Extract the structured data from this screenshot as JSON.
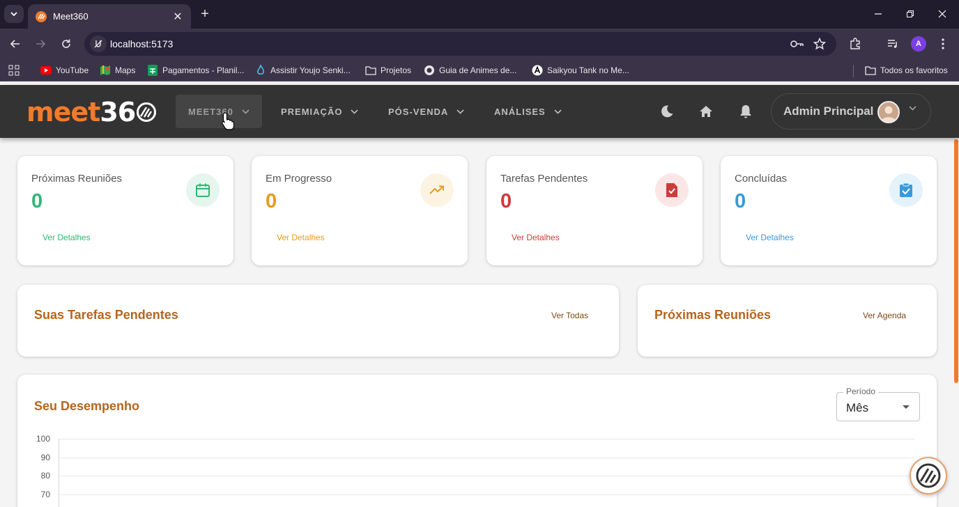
{
  "browser": {
    "tab_title": "Meet360",
    "url": "localhost:5173",
    "bookmarks": [
      {
        "label": "YouTube",
        "icon": "youtube-icon"
      },
      {
        "label": "Maps",
        "icon": "maps-icon"
      },
      {
        "label": "Pagamentos - Planil...",
        "icon": "sheets-icon"
      },
      {
        "label": "Assistir Youjo Senki...",
        "icon": "site-icon"
      },
      {
        "label": "Projetos",
        "icon": "folder-icon"
      },
      {
        "label": "Guia de Animes de...",
        "icon": "globe-icon"
      },
      {
        "label": "Saikyou Tank no Me...",
        "icon": "site-icon"
      }
    ],
    "all_bookmarks": "Todos os favoritos",
    "profile_initial": "A"
  },
  "app": {
    "logo_meet": "meet",
    "logo_num": "36",
    "nav": [
      {
        "label": "MEET360",
        "active": true
      },
      {
        "label": "PREMIAÇÃO",
        "active": false
      },
      {
        "label": "PÓS-VENDA",
        "active": false
      },
      {
        "label": "ANÁLISES",
        "active": false
      }
    ],
    "user_name": "Admin Principal"
  },
  "stats": [
    {
      "label": "Próximas Reuniões",
      "value": "0",
      "link": "Ver Detalhes",
      "color": "#2eb872",
      "bg": "#e6f6ee",
      "icon": "calendar-icon"
    },
    {
      "label": "Em Progresso",
      "value": "0",
      "link": "Ver Detalhes",
      "color": "#e89b1c",
      "bg": "#fdf3e3",
      "icon": "trending-up-icon"
    },
    {
      "label": "Tarefas Pendentes",
      "value": "0",
      "link": "Ver Detalhes",
      "color": "#d13a3a",
      "bg": "#fbe6e6",
      "icon": "assignment-late-icon"
    },
    {
      "label": "Concluídas",
      "value": "0",
      "link": "Ver Detalhes",
      "color": "#3a9ad9",
      "bg": "#e4f2fb",
      "icon": "assignment-done-icon"
    }
  ],
  "tasks": {
    "title": "Suas Tarefas Pendentes",
    "link": "Ver Todas"
  },
  "meetings": {
    "title": "Próximas Reuniões",
    "link": "Ver Agenda"
  },
  "performance": {
    "title": "Seu Desempenho",
    "period_label": "Período",
    "period_value": "Mês"
  },
  "chart_data": {
    "type": "line",
    "title": "Seu Desempenho",
    "y_ticks": [
      "100",
      "90",
      "80",
      "70"
    ],
    "ylim": [
      70,
      100
    ],
    "series": [],
    "grid": true
  }
}
